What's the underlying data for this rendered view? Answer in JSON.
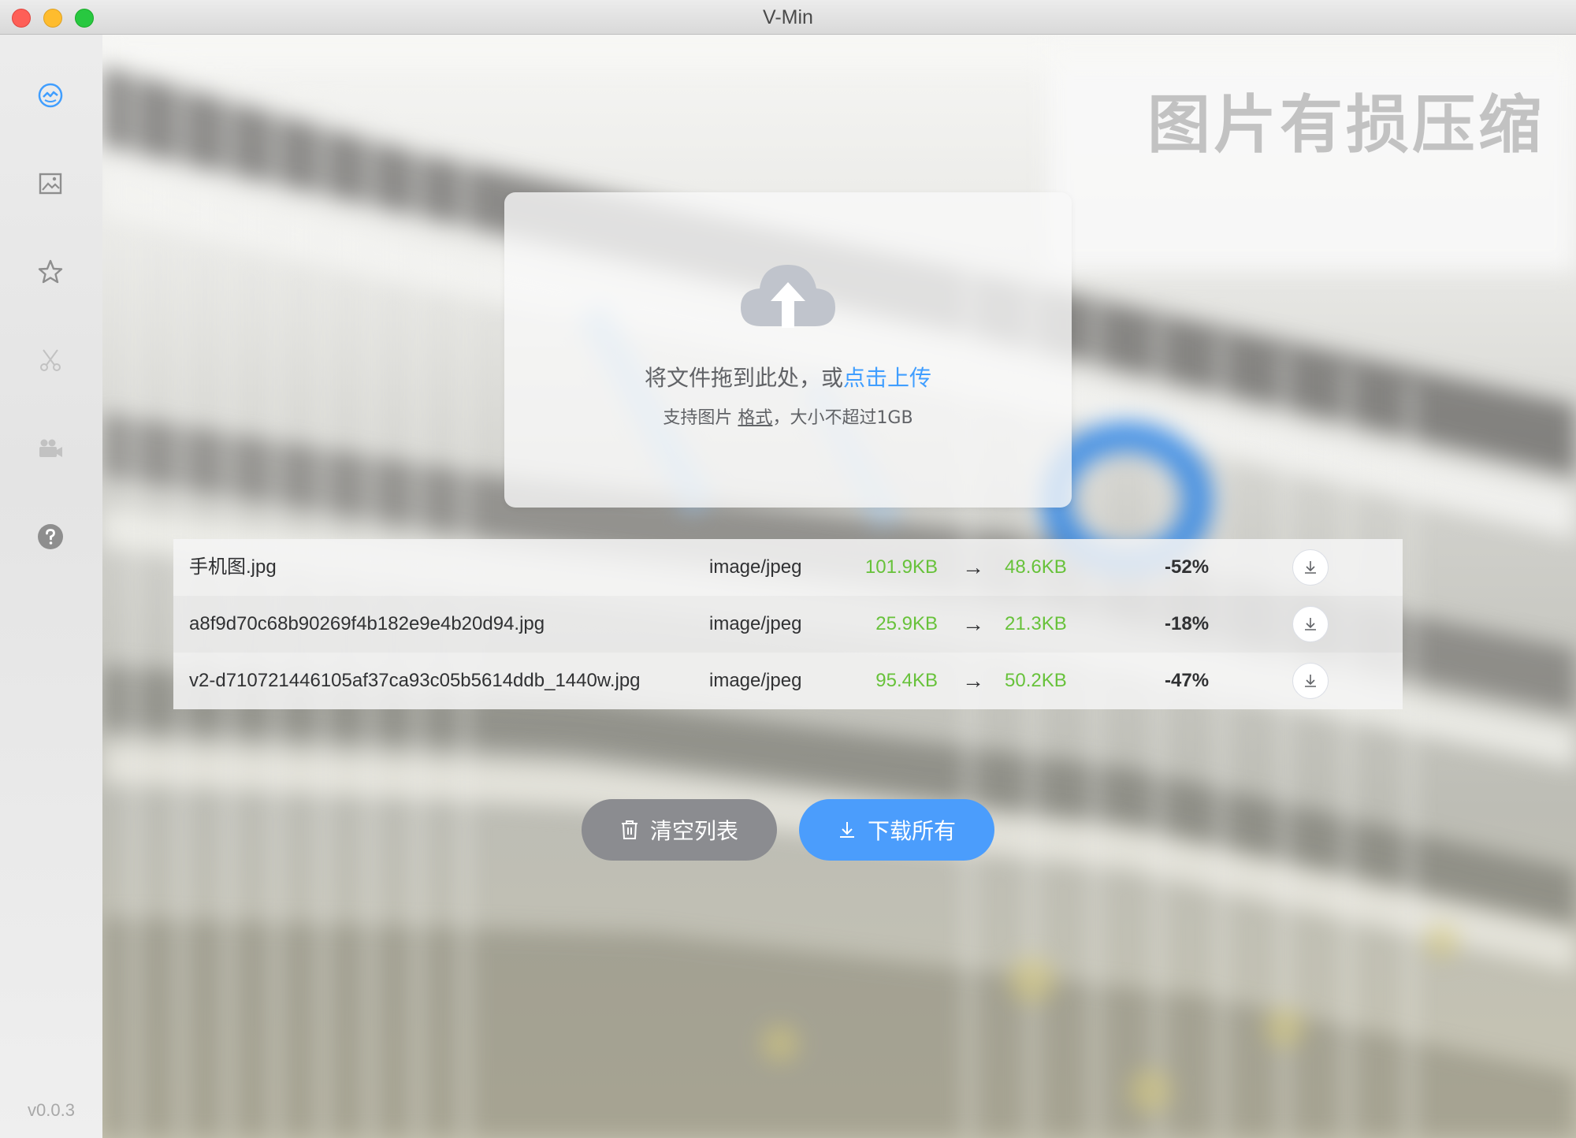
{
  "window": {
    "title": "V-Min"
  },
  "sidebar": {
    "items": [
      {
        "icon": "compress-icon",
        "active": true
      },
      {
        "icon": "image-icon",
        "active": false
      },
      {
        "icon": "star-icon",
        "active": false
      },
      {
        "icon": "scissors-icon",
        "active": false
      },
      {
        "icon": "video-camera-icon",
        "active": false
      },
      {
        "icon": "help-icon",
        "active": false
      }
    ],
    "version": "v0.0.3"
  },
  "main": {
    "heading": "图片有损压缩",
    "upload": {
      "prompt": "将文件拖到此处，或",
      "link": "点击上传",
      "sub_prefix": "支持图片",
      "sub_format": "格式",
      "sub_suffix": "，大小不超过1GB"
    },
    "files": [
      {
        "name": "手机图.jpg",
        "type": "image/jpeg",
        "original": "101.9KB",
        "arrow": "→",
        "compressed": "48.6KB",
        "reduction": "-52%"
      },
      {
        "name": "a8f9d70c68b90269f4b182e9e4b20d94.jpg",
        "type": "image/jpeg",
        "original": "25.9KB",
        "arrow": "→",
        "compressed": "21.3KB",
        "reduction": "-18%"
      },
      {
        "name": "v2-d710721446105af37ca93c05b5614ddb_1440w.jpg",
        "type": "image/jpeg",
        "original": "95.4KB",
        "arrow": "→",
        "compressed": "50.2KB",
        "reduction": "-47%"
      }
    ],
    "actions": {
      "clear_label": "清空列表",
      "download_all_label": "下载所有"
    }
  },
  "colors": {
    "accent": "#409eff",
    "size_green": "#67c23a",
    "clear_button": "#8b8c90",
    "download_button": "#4b9dfc"
  }
}
